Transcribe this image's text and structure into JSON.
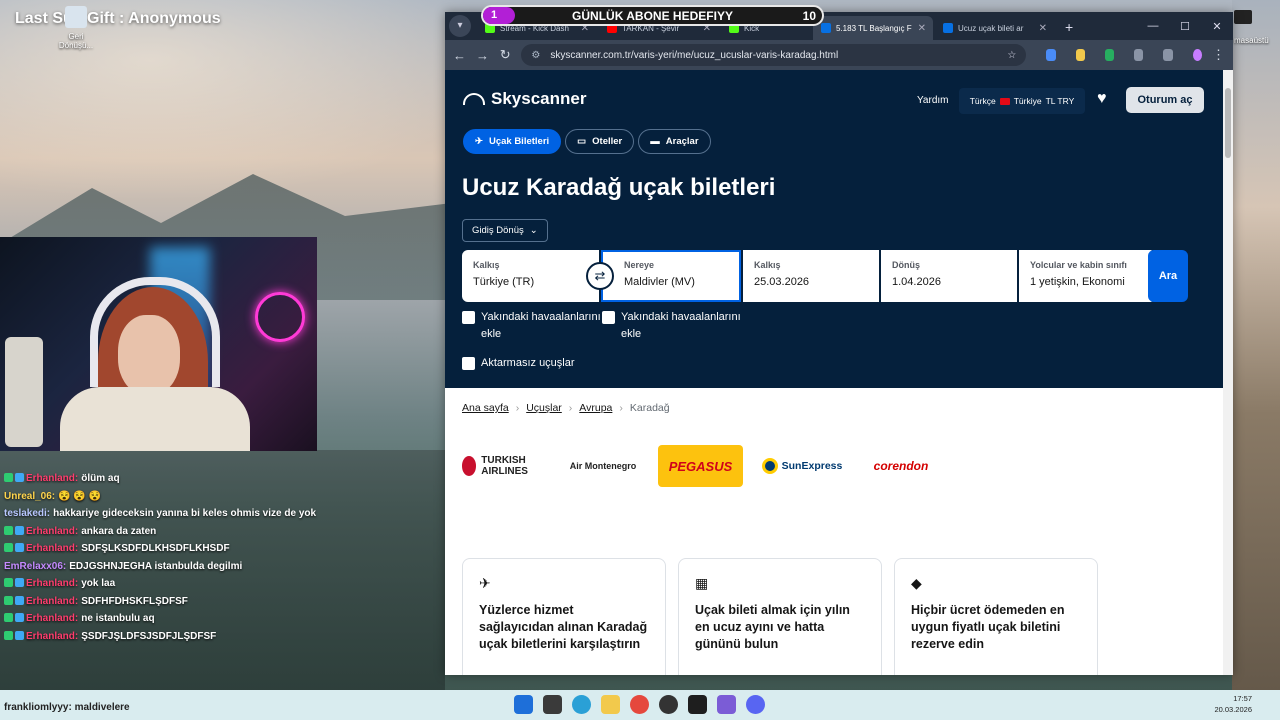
{
  "desktop": {
    "gift_title": "Last Sub Gift : Anonymous",
    "icon_label": "Geri Dönüşü...",
    "right_icon_label": "masaüstü"
  },
  "goal": {
    "count": "1",
    "title": "GÜNLÜK ABONE HEDEFIYY",
    "total": "10",
    "progress": 0.1
  },
  "chat": [
    {
      "user": "Erhanland:",
      "color": "#ff3d6e",
      "text": "ölüm aq"
    },
    {
      "user": "Unreal_06:",
      "color": "#ffd54d",
      "text": "😵 😵 😵"
    },
    {
      "user": "teslakedi:",
      "color": "#b8c7ff",
      "text": "hakkariye gideceksin yanına bi keles ohmis vize de yok"
    },
    {
      "user": "Erhanland:",
      "color": "#ff3d6e",
      "text": "ankara da zaten"
    },
    {
      "user": "Erhanland:",
      "color": "#ff3d6e",
      "text": "SDFŞLKSDFDLKHSDFLKHSDF"
    },
    {
      "user": "EmRelaxx06:",
      "color": "#c58aff",
      "text": "EDJGSHNJEGHA istanbulda degilmi"
    },
    {
      "user": "Erhanland:",
      "color": "#ff3d6e",
      "text": "yok laa"
    },
    {
      "user": "Erhanland:",
      "color": "#ff3d6e",
      "text": "SDFHFDHSKFLŞDFSF"
    },
    {
      "user": "Erhanland:",
      "color": "#ff3d6e",
      "text": "ne istanbulu aq"
    },
    {
      "user": "Erhanland:",
      "color": "#ff3d6e",
      "text": "ŞSDFJŞLDFSJSDFJLŞDFSF"
    }
  ],
  "browser": {
    "tabs": [
      {
        "label": "Stream - Kick Dash",
        "color": "#53fc18",
        "active": false
      },
      {
        "label": "TARKAN - Şevir",
        "color": "#ff0000",
        "active": false
      },
      {
        "label": "Kick",
        "color": "#53fc18",
        "active": false
      },
      {
        "label": "5.183 TL Başlangıç F",
        "color": "#0770e3",
        "active": true
      },
      {
        "label": "Ucuz uçak bileti ar",
        "color": "#0770e3",
        "active": false
      }
    ],
    "url": "skyscanner.com.tr/varis-yeri/me/ucuz_ucuslar-varis-karadag.html"
  },
  "site": {
    "brand": "Skyscanner",
    "help": "Yardım",
    "locale": [
      "Türkçe",
      "Türkiye",
      "TL TRY"
    ],
    "login": "Oturum aç",
    "nav": [
      "Uçak Biletleri",
      "Oteller",
      "Araçlar"
    ],
    "title": "Ucuz Karadağ uçak biletleri",
    "trip_type": "Gidiş Dönüş",
    "fields": {
      "from_label": "Kalkış",
      "from_value": "Türkiye (TR)",
      "to_label": "Nereye",
      "to_value": "Maldivler (MV)",
      "dep_label": "Kalkış",
      "dep_value": "25.03.2026",
      "ret_label": "Dönüş",
      "ret_value": "1.04.2026",
      "pax_label": "Yolcular ve kabin sınıfı",
      "pax_value": "1 yetişkin, Ekonomi"
    },
    "search": "Ara",
    "checks": [
      "Yakındaki havaalanlarını ekle",
      "Yakındaki havaalanlarını ekle",
      "Aktarmasız uçuşlar"
    ],
    "breadcrumb": [
      "Ana sayfa",
      "Uçuşlar",
      "Avrupa",
      "Karadağ"
    ],
    "airlines": [
      "TURKISH AIRLINES",
      "Air Montenegro",
      "PEGASUS",
      "SunExpress",
      "corendon"
    ],
    "cards": [
      "Yüzlerce hizmet sağlayıcıdan alınan Karadağ uçak biletlerini karşılaştırın",
      "Uçak bileti almak için yılın en ucuz ayını ve hatta gününü bulun",
      "Hiçbir ücret ödemeden en uygun fiyatlı uçak biletini rezerve edin"
    ]
  },
  "taskbar": {
    "chat_line": "frankliomlyyy: maldivelere",
    "time": "17:57",
    "date": "20.03.2026"
  }
}
